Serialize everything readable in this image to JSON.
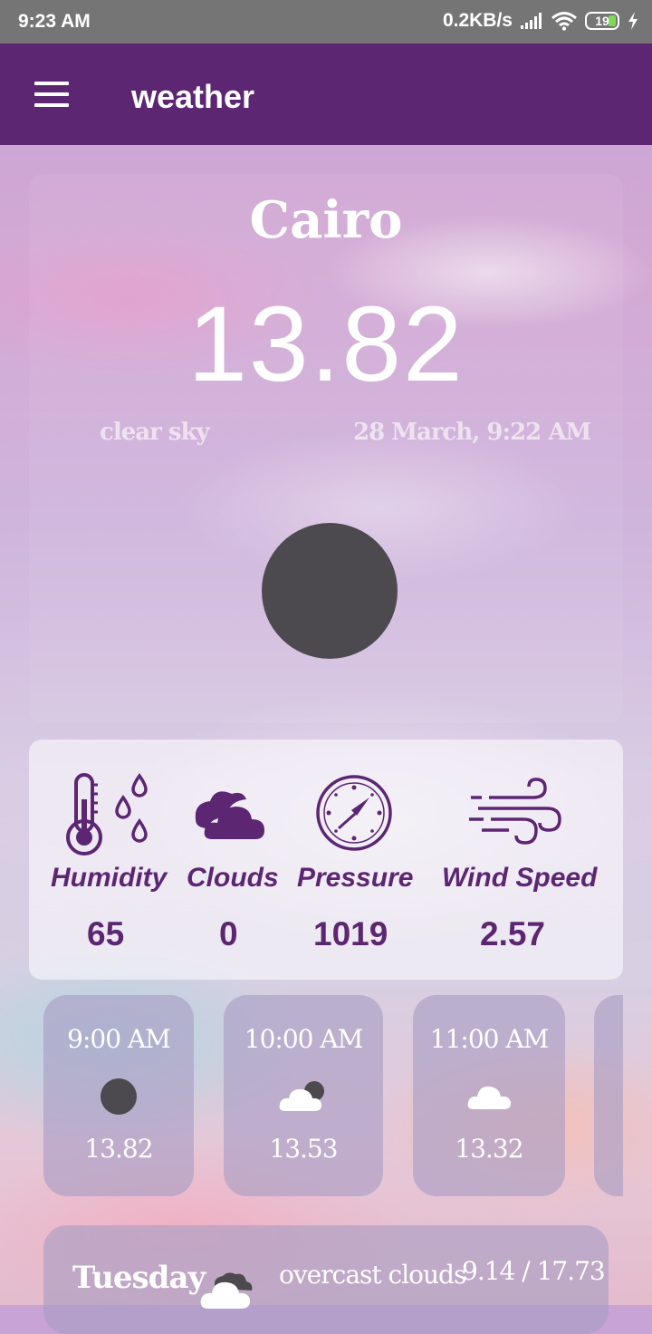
{
  "status_bar": {
    "time": "9:23 AM",
    "network_speed": "0.2KB/s",
    "battery_level": "19",
    "icons": [
      "signal-icon",
      "wifi-icon",
      "battery-icon",
      "charging-icon"
    ]
  },
  "toolbar": {
    "title": "weather",
    "menu_icon": "menu-icon"
  },
  "current": {
    "city": "Cairo",
    "temperature": "13.82",
    "description": "clear sky",
    "datetime": "28 March, 9:22 AM",
    "icon": "clear-night-icon"
  },
  "stats": [
    {
      "label": "Humidity",
      "value": "65",
      "icon": "thermometer-droplets-icon"
    },
    {
      "label": "Clouds",
      "value": "0",
      "icon": "cloud-icon"
    },
    {
      "label": "Pressure",
      "value": "1019",
      "icon": "gauge-icon"
    },
    {
      "label": "Wind Speed",
      "value": "2.57",
      "icon": "wind-icon"
    }
  ],
  "hourly": [
    {
      "time": "9:00 AM",
      "temp": "13.82",
      "icon": "clear-night-icon"
    },
    {
      "time": "10:00 AM",
      "temp": "13.53",
      "icon": "partly-cloudy-night-icon"
    },
    {
      "time": "11:00 AM",
      "temp": "13.32",
      "icon": "cloud-icon"
    }
  ],
  "daily": [
    {
      "day": "Tuesday",
      "description": "overcast clouds",
      "range": "9.14 / 17.73",
      "icon": "overcast-clouds-icon"
    }
  ],
  "colors": {
    "primary": "#5c2672",
    "status_bar": "#757575",
    "icon_dark": "#4c4a4f"
  }
}
